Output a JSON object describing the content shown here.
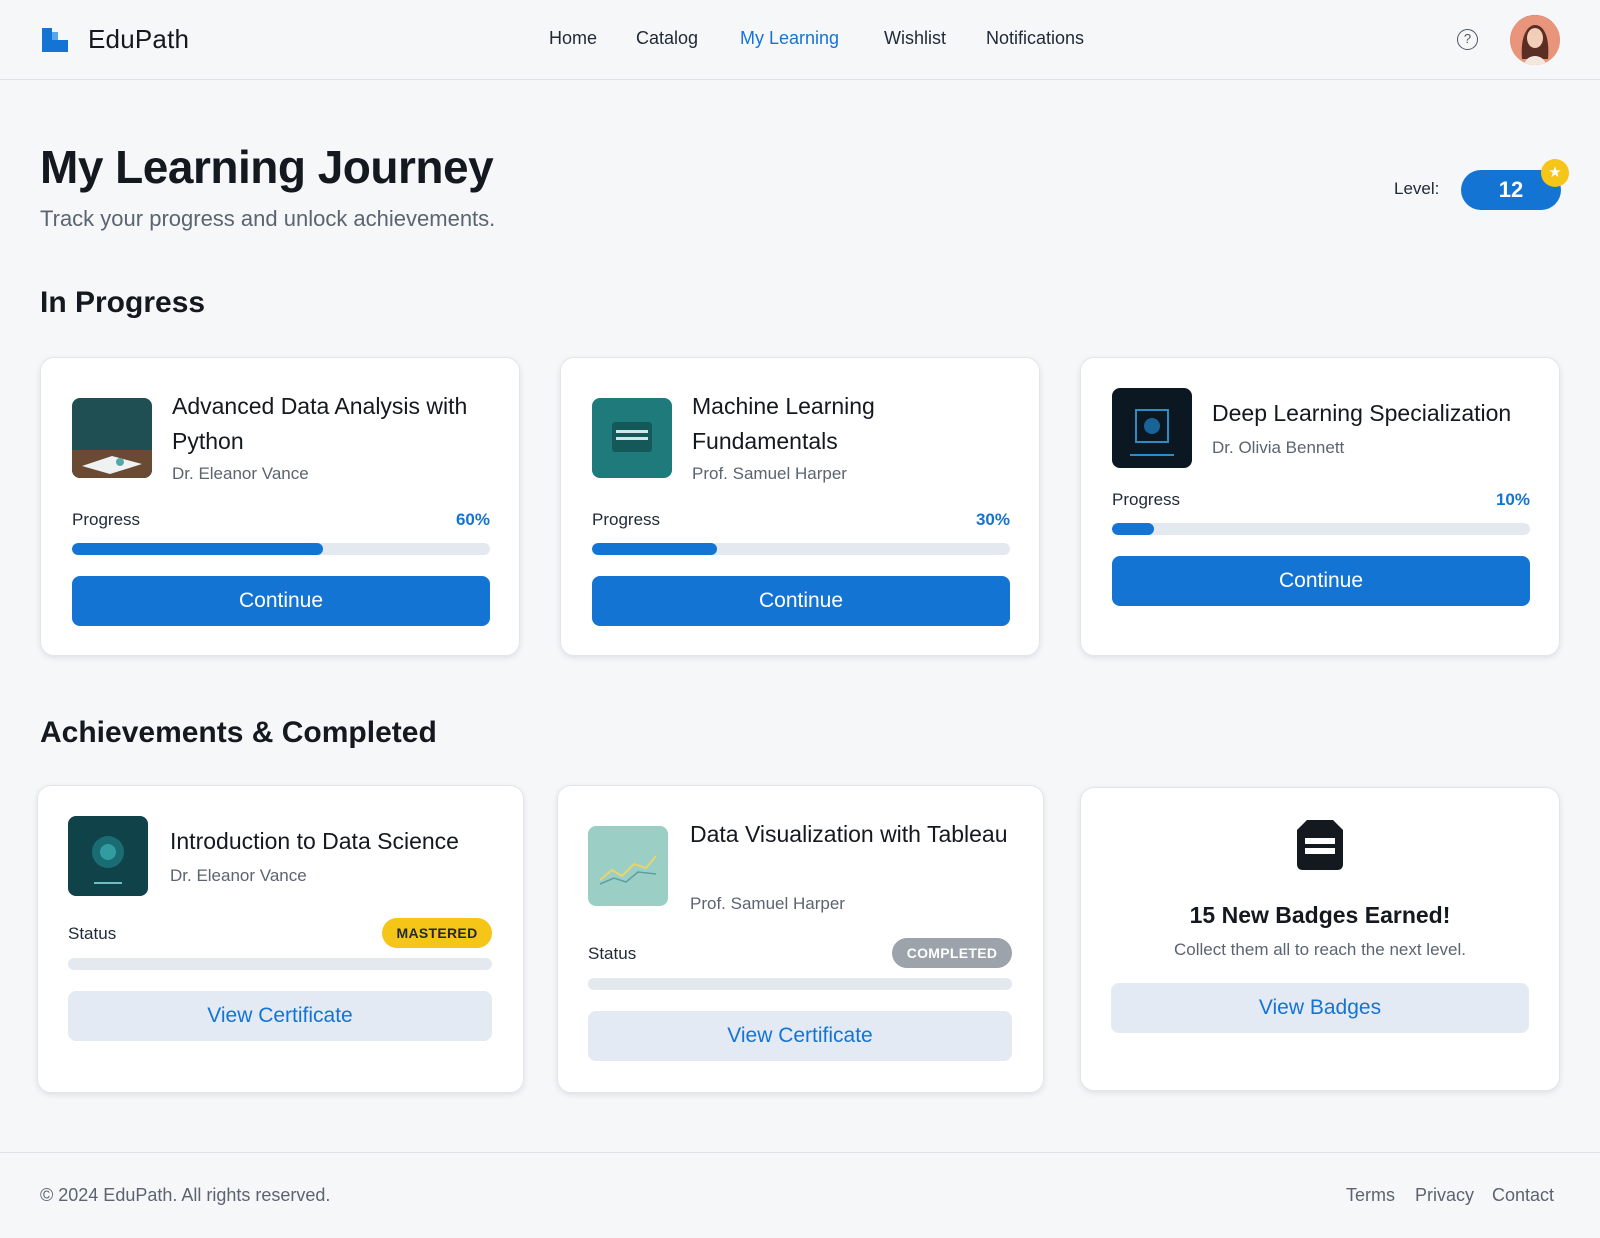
{
  "header": {
    "brand": "EduPath",
    "nav": [
      "Home",
      "Catalog",
      "My Learning",
      "Wishlist",
      "Notifications"
    ],
    "active_nav": "My Learning",
    "help_icon": "question-circle-icon",
    "avatar_icon": "user-avatar"
  },
  "hero": {
    "title": "My Learning Journey",
    "subtitle": "Track your progress and unlock achievements.",
    "level_label": "Level:",
    "level_value": "12",
    "level_star_icon": "star-icon"
  },
  "in_progress": {
    "title": "In Progress",
    "progress_label": "Progress",
    "button_label": "Continue",
    "courses": [
      {
        "title": "Advanced Data Analysis with Python",
        "instructor": "Dr. Eleanor Vance",
        "progress_text": "60%",
        "progress": 0.6
      },
      {
        "title": "Machine Learning Fundamentals",
        "instructor": "Prof. Samuel Harper",
        "progress_text": "30%",
        "progress": 0.3
      },
      {
        "title": "Deep Learning Specialization",
        "instructor": "Dr. Olivia Bennett",
        "progress_text": "10%",
        "progress": 0.1
      }
    ]
  },
  "completed": {
    "title": "Achievements & Completed",
    "status_label": "Status",
    "button_label": "View Certificate",
    "courses": [
      {
        "title": "Introduction to Data Science",
        "instructor": "Dr. Eleanor Vance",
        "badge": "MASTERED"
      },
      {
        "title": "Data Visualization with Tableau",
        "instructor": "Prof. Samuel Harper",
        "badge": "COMPLETED"
      }
    ],
    "badges_card": {
      "title": "15 New Badges Earned!",
      "subtitle": "Collect them all to reach the next level.",
      "button_label": "View Badges",
      "icon": "badge-icon"
    }
  },
  "footer": {
    "copyright": "© 2024 EduPath. All rights reserved.",
    "links": [
      "Terms",
      "Privacy",
      "Contact"
    ]
  },
  "colors": {
    "accent": "#1474d4",
    "mastered": "#f5c518",
    "completed": "#9ca3ab"
  }
}
